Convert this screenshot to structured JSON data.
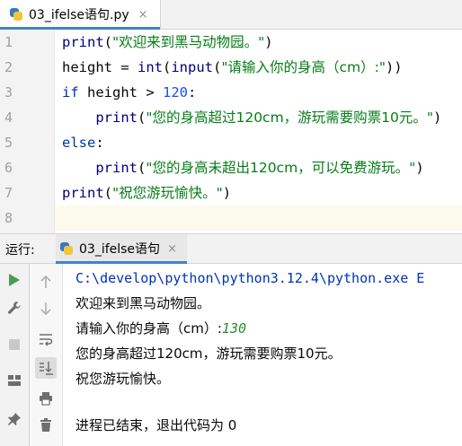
{
  "editor_tab": {
    "label": "03_ifelse语句.py",
    "close": "×"
  },
  "editor": {
    "line_numbers": [
      "1",
      "2",
      "3",
      "4",
      "5",
      "6",
      "7",
      "8"
    ],
    "lines": {
      "l1": {
        "fn": "print",
        "open": "(",
        "str": "\"欢迎来到黑马动物园。\"",
        "close": ")"
      },
      "l2": {
        "a": "height = ",
        "fn1": "int",
        "p1": "(",
        "fn2": "input",
        "p2": "(",
        "str": "\"请输入你的身高（cm）:\"",
        "close": "))"
      },
      "l3": {
        "kw": "if",
        "mid": " height > ",
        "num": "120",
        "colon": ":"
      },
      "l4": {
        "indent": "    ",
        "fn": "print",
        "open": "(",
        "str": "\"您的身高超过120cm，游玩需要购票10元。\"",
        "close": ")"
      },
      "l5": {
        "kw": "else",
        "colon": ":"
      },
      "l6": {
        "indent": "    ",
        "fn": "print",
        "open": "(",
        "str": "\"您的身高未超出120cm，可以免费游玩。\"",
        "close": ")"
      },
      "l7": {
        "fn": "print",
        "open": "(",
        "str": "\"祝您游玩愉快。\"",
        "close": ")"
      }
    }
  },
  "run_panel": {
    "title": "运行:",
    "tab_label": "03_ifelse语句",
    "tab_close": "×",
    "left_tools": [
      "run-icon",
      "wrench-icon",
      "stop-icon",
      "layout-icon",
      "pin-icon"
    ],
    "right_tools": [
      "arrow-up-icon",
      "arrow-down-icon",
      "soft-wrap-icon",
      "scroll-to-end-icon",
      "print-icon",
      "trash-icon"
    ]
  },
  "console": {
    "path": "C:\\develop\\python\\python3.12.4\\python.exe E",
    "out1": "欢迎来到黑马动物园。",
    "prompt": "请输入你的身高（cm）:",
    "user_input": "130",
    "out2": "您的身高超过120cm，游玩需要购票10元。",
    "out3": "祝您游玩愉快。",
    "exit": "进程已结束，退出代码为 0"
  },
  "colors": {
    "keyword": "#0033b3",
    "string": "#067d17",
    "number": "#1750eb",
    "run_green": "#499c54",
    "tab_underline": "#4083c9"
  }
}
